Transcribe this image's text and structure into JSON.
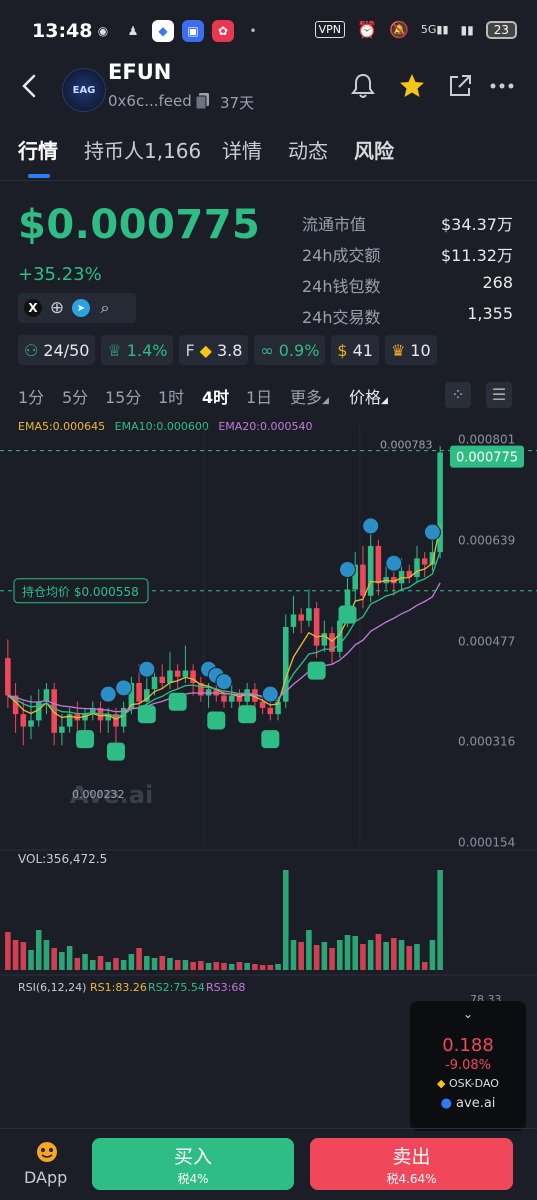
{
  "status": {
    "time": "13:48",
    "vpn": "VPN",
    "battery": "23",
    "network": "5G"
  },
  "header": {
    "name": "EFUN",
    "address": "0x6c...feed",
    "age": "37天",
    "logo_text": "EAG"
  },
  "tabs": [
    {
      "label": "行情"
    },
    {
      "label": "持币人1,166"
    },
    {
      "label": "详情"
    },
    {
      "label": "动态"
    },
    {
      "label": "风险"
    }
  ],
  "price": {
    "value": "$0.000775",
    "change": "+35.23%"
  },
  "stats": [
    {
      "label": "流通市值",
      "value": "$34.37万"
    },
    {
      "label": "24h成交额",
      "value": "$11.32万"
    },
    {
      "label": "24h钱包数",
      "value": "268"
    },
    {
      "label": "24h交易数",
      "value": "1,355"
    }
  ],
  "badges": [
    {
      "icon": "holders-icon",
      "value": "24/50",
      "color": "#2ebd85"
    },
    {
      "icon": "chef-hat-icon",
      "value": "1.4%",
      "color": "#2ebd85"
    },
    {
      "icon": "f-coin-icon",
      "prefix": "F",
      "value": "3.8",
      "color": "#e6e8ee"
    },
    {
      "icon": "link-icon",
      "value": "0.9%",
      "color": "#2ebd85"
    },
    {
      "icon": "money-bag-icon",
      "value": "41",
      "color": "#e6e8ee"
    },
    {
      "icon": "trophy-icon",
      "value": "10",
      "color": "#e6e8ee"
    }
  ],
  "timeframes": [
    "1分",
    "5分",
    "15分",
    "1时",
    "4时",
    "1日",
    "更多",
    "价格"
  ],
  "active_timeframe": "4时",
  "ema": {
    "ema5": "EMA5:0.000645",
    "ema10": "EMA10:0.000600",
    "ema20": "EMA20:0.000540"
  },
  "chart_data": {
    "type": "candlestick",
    "y_ticks": [
      "0.000801",
      "0.000639",
      "0.000477",
      "0.000316",
      "0.000154"
    ],
    "high_label": "0.000783",
    "low_label": "0.000232",
    "current_price": "0.000775",
    "avg_cost_label": "持仓均价 $0.000558",
    "volume_label": "VOL:356,472.5",
    "rsi": {
      "label": "RSI(6,12,24)",
      "rs1": "RS1:83.26",
      "rs2": "RS2:75.54",
      "rs3": "RS3:68"
    },
    "rsi_partial_tick": "78.33",
    "watermark": "Ave.ai",
    "candles": [
      [
        0.00045,
        0.00039,
        0.00048,
        0.00037
      ],
      [
        0.00039,
        0.00036,
        0.00041,
        0.00033
      ],
      [
        0.00036,
        0.00034,
        0.00038,
        0.00031
      ],
      [
        0.00034,
        0.00035,
        0.00039,
        0.00032
      ],
      [
        0.00035,
        0.00038,
        0.0004,
        0.00034
      ],
      [
        0.00038,
        0.0004,
        0.00041,
        0.00036
      ],
      [
        0.0004,
        0.00033,
        0.00041,
        0.00031
      ],
      [
        0.00033,
        0.00034,
        0.00036,
        0.00031
      ],
      [
        0.00034,
        0.00036,
        0.00037,
        0.00033
      ],
      [
        0.00036,
        0.00035,
        0.00038,
        0.00033
      ],
      [
        0.00035,
        0.00036,
        0.00037,
        0.00033
      ],
      [
        0.00036,
        0.00037,
        0.00038,
        0.00035
      ],
      [
        0.00037,
        0.00035,
        0.00038,
        0.00033
      ],
      [
        0.00035,
        0.00036,
        0.00037,
        0.00033
      ],
      [
        0.00036,
        0.00034,
        0.00037,
        0.00031
      ],
      [
        0.00034,
        0.00037,
        0.00038,
        0.00033
      ],
      [
        0.00037,
        0.00041,
        0.00042,
        0.00036
      ],
      [
        0.00041,
        0.00038,
        0.00044,
        0.00037
      ],
      [
        0.00038,
        0.0004,
        0.00042,
        0.00036
      ],
      [
        0.0004,
        0.00042,
        0.00043,
        0.00039
      ],
      [
        0.00042,
        0.00041,
        0.00044,
        0.0004
      ],
      [
        0.00041,
        0.00043,
        0.00046,
        0.0004
      ],
      [
        0.00043,
        0.00042,
        0.00044,
        0.0004
      ],
      [
        0.00042,
        0.00043,
        0.00047,
        0.00041
      ],
      [
        0.00043,
        0.00041,
        0.00044,
        0.00039
      ],
      [
        0.00041,
        0.00039,
        0.00042,
        0.00038
      ],
      [
        0.00039,
        0.0004,
        0.00041,
        0.00037
      ],
      [
        0.0004,
        0.00039,
        0.00041,
        0.00038
      ],
      [
        0.00039,
        0.00038,
        0.0004,
        0.00037
      ],
      [
        0.00038,
        0.00039,
        0.00041,
        0.00037
      ],
      [
        0.00039,
        0.00038,
        0.0004,
        0.00036
      ],
      [
        0.00038,
        0.0004,
        0.00041,
        0.00037
      ],
      [
        0.0004,
        0.00038,
        0.00041,
        0.00037
      ],
      [
        0.00038,
        0.00037,
        0.00039,
        0.00036
      ],
      [
        0.00037,
        0.00036,
        0.00038,
        0.00035
      ],
      [
        0.00036,
        0.00038,
        0.00039,
        0.00035
      ],
      [
        0.00038,
        0.0005,
        0.00052,
        0.00037
      ],
      [
        0.0005,
        0.00052,
        0.00055,
        0.00049
      ],
      [
        0.00052,
        0.00051,
        0.00053,
        0.00049
      ],
      [
        0.00051,
        0.00053,
        0.00056,
        0.0005
      ],
      [
        0.00053,
        0.00047,
        0.00054,
        0.00045
      ],
      [
        0.00047,
        0.00049,
        0.00051,
        0.00046
      ],
      [
        0.00049,
        0.00046,
        0.0005,
        0.00044
      ],
      [
        0.00046,
        0.00051,
        0.00052,
        0.00045
      ],
      [
        0.00051,
        0.00056,
        0.00058,
        0.0005
      ],
      [
        0.00056,
        0.0006,
        0.00062,
        0.00054
      ],
      [
        0.0006,
        0.00055,
        0.00063,
        0.00053
      ],
      [
        0.00055,
        0.00063,
        0.00065,
        0.00054
      ],
      [
        0.00063,
        0.00057,
        0.00064,
        0.00055
      ],
      [
        0.00057,
        0.00058,
        0.0006,
        0.00056
      ],
      [
        0.00058,
        0.00057,
        0.00059,
        0.00055
      ],
      [
        0.00057,
        0.00059,
        0.00061,
        0.00056
      ],
      [
        0.00059,
        0.00058,
        0.0006,
        0.00057
      ],
      [
        0.00058,
        0.00061,
        0.00063,
        0.00057
      ],
      [
        0.00061,
        0.0006,
        0.00062,
        0.00058
      ],
      [
        0.0006,
        0.00062,
        0.00064,
        0.00059
      ],
      [
        0.00062,
        0.00078,
        0.00079,
        0.00061
      ]
    ],
    "volumes": [
      38,
      30,
      28,
      20,
      40,
      30,
      22,
      18,
      24,
      12,
      16,
      10,
      14,
      8,
      12,
      10,
      16,
      22,
      14,
      12,
      14,
      12,
      10,
      10,
      8,
      9,
      7,
      8,
      7,
      6,
      8,
      7,
      6,
      5,
      5,
      6,
      100,
      30,
      28,
      40,
      25,
      28,
      22,
      30,
      35,
      34,
      26,
      30,
      36,
      28,
      32,
      30,
      24,
      26,
      8,
      30,
      100
    ]
  },
  "popup": {
    "price": "0.188",
    "change": "-9.08%",
    "name": "OSK-DAO",
    "brand": "ave.ai"
  },
  "bottom": {
    "dapp": "DApp",
    "buy": "买入",
    "buy_tax": "税4%",
    "sell": "卖出",
    "sell_tax": "税4.64%"
  }
}
